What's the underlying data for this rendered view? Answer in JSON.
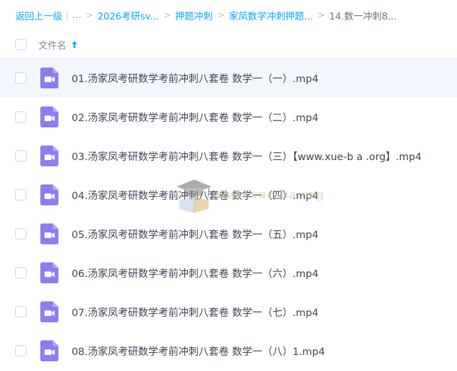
{
  "breadcrumb": {
    "back_label": "返回上一级",
    "pipe": "|",
    "dots": "...",
    "items": [
      "2026考研sv...",
      "押题冲刺",
      "家凤数学冲刺押题...",
      "14.数一冲刺8..."
    ],
    "separator": ">"
  },
  "list_header": {
    "name_label": "文件名",
    "sort_icon": "arrow-up-icon"
  },
  "files": [
    {
      "name": "01.汤家凤考研数学考前冲刺八套卷 数学一（一）.mp4",
      "icon": "video-file-icon"
    },
    {
      "name": "02.汤家凤考研数学考前冲刺八套卷 数学一（二）.mp4",
      "icon": "video-file-icon"
    },
    {
      "name": "03.汤家凤考研数学考前冲刺八套卷 数学一（三）【www.xue-b a .org】.mp4",
      "icon": "video-file-icon"
    },
    {
      "name": "04.汤家凤考研数学考前冲刺八套卷 数学一（四）.mp4",
      "icon": "video-file-icon"
    },
    {
      "name": "05.汤家凤考研数学考前冲刺八套卷 数学一（五）.mp4",
      "icon": "video-file-icon"
    },
    {
      "name": "06.汤家凤考研数学考前冲刺八套卷 数学一（六）.mp4",
      "icon": "video-file-icon"
    },
    {
      "name": "07.汤家凤考研数学考前冲刺八套卷 数学一（七）.mp4",
      "icon": "video-file-icon"
    },
    {
      "name": "08.汤家凤考研数学考前冲刺八套卷 数学一（八）1.mp4",
      "icon": "video-file-icon"
    }
  ],
  "watermark": {
    "text": "www.xue-ba.org",
    "icon": "graduation-cap-book-icon"
  },
  "colors": {
    "link": "#06a7ff",
    "icon_purple": "#8e7cf2",
    "selected_row": "#f3f7fd",
    "text": "#3d4454"
  }
}
